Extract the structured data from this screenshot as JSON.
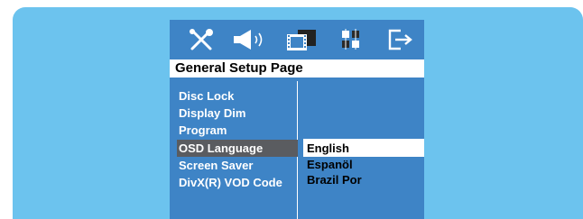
{
  "colors": {
    "panel_bg": "#6cc3ee",
    "osd_bg": "#3e84c6",
    "highlight": "#5a5c60"
  },
  "icons": [
    "tools-icon",
    "speaker-icon",
    "film-icon",
    "settings-grid-icon",
    "exit-icon"
  ],
  "title": "General Setup Page",
  "menu": [
    {
      "label": "Disc Lock"
    },
    {
      "label": "Display Dim"
    },
    {
      "label": "Program"
    },
    {
      "label": "OSD Language"
    },
    {
      "label": "Screen Saver"
    },
    {
      "label": "DivX(R) VOD Code"
    }
  ],
  "selected_menu_index": 3,
  "options": [
    {
      "label": "English"
    },
    {
      "label": "Espanöl"
    },
    {
      "label": "Brazil Por"
    }
  ],
  "selected_option_index": 0
}
